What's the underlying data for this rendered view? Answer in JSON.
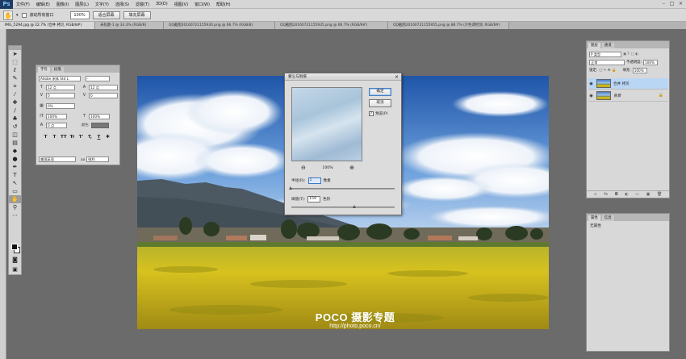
{
  "menubar": {
    "logo": "Ps",
    "items": [
      "文件(F)",
      "编辑(E)",
      "图像(I)",
      "图层(L)",
      "文字(Y)",
      "选择(S)",
      "滤镜(T)",
      "3D(D)",
      "视图(V)",
      "窗口(W)",
      "帮助(H)"
    ]
  },
  "options_bar": {
    "scroll_all_label": "滚动所有窗口",
    "zoom_value": "100%",
    "fit_screen_label": "适合屏幕",
    "fill_screen_label": "填充屏幕"
  },
  "doc_tabs": [
    "IMG_5294.jpg @ 22.7% (合并 拷贝, RGB/8#)",
    "未标题-1 @ 33.3% (RGB/8)",
    "QQ截图20160721155930.png @ 66.7% (RGB/8)",
    "QQ截图20160721155935.png @ 66.7% (RGB/8#)",
    "QQ截图20160721155955.png @ 88.7% (冷色调检测, RGB/8#)"
  ],
  "character_panel": {
    "tabs": [
      "字符",
      "段落"
    ],
    "font_family": "Adobe 宋体 Std L",
    "font_style": "-",
    "font_size": "12 点",
    "leading": "12 点",
    "kerning": "0",
    "tracking": "0",
    "scale_percent": "0%",
    "vertical_scale": "100%",
    "horizontal_scale": "100%",
    "baseline": "0 点",
    "color_label": "颜色:",
    "style_buttons": [
      "T",
      "T",
      "TT",
      "Tr",
      "T'",
      "T,",
      "T",
      "T"
    ],
    "language": "美国英语",
    "aa": "aa",
    "aa_mode": "锐利"
  },
  "dialog": {
    "title": "蒙尘与划痕",
    "close": "×",
    "ok_label": "确定",
    "cancel_label": "取消",
    "preview_label": "预览(P)",
    "preview_checked": "✓",
    "zoom_out": "⊖",
    "zoom_in": "⊕",
    "zoom_percent": "100%",
    "radius_label": "半径(R):",
    "radius_value": "1",
    "radius_unit": "像素",
    "threshold_label": "阈值(T):",
    "threshold_value": "159",
    "threshold_unit": "色阶",
    "radius_fraction": 0.0,
    "threshold_fraction": 0.62
  },
  "layers_panel": {
    "tabs": [
      "图层",
      "通道"
    ],
    "filter_kind": "P 类型",
    "blend_mode": "正常",
    "opacity_label": "不透明度:",
    "opacity_value": "100%",
    "lock_label": "锁定:",
    "fill_label": "填充:",
    "fill_value": "100%",
    "layers": [
      {
        "name": "合并 拷贝",
        "selected": true
      },
      {
        "name": "背景",
        "selected": false
      }
    ]
  },
  "properties_panel": {
    "tabs": [
      "属性",
      "信息"
    ],
    "body": "无属性"
  },
  "watermark": {
    "main": "POCO 摄影专题",
    "sub": "http://photo.poco.cn/"
  },
  "colors": {
    "sky_top": "#2d63b4",
    "sky_low": "#8fb8e6",
    "mountain": "#4f5b63",
    "field": "#cdb82a",
    "selection": "#b9d6f5"
  }
}
